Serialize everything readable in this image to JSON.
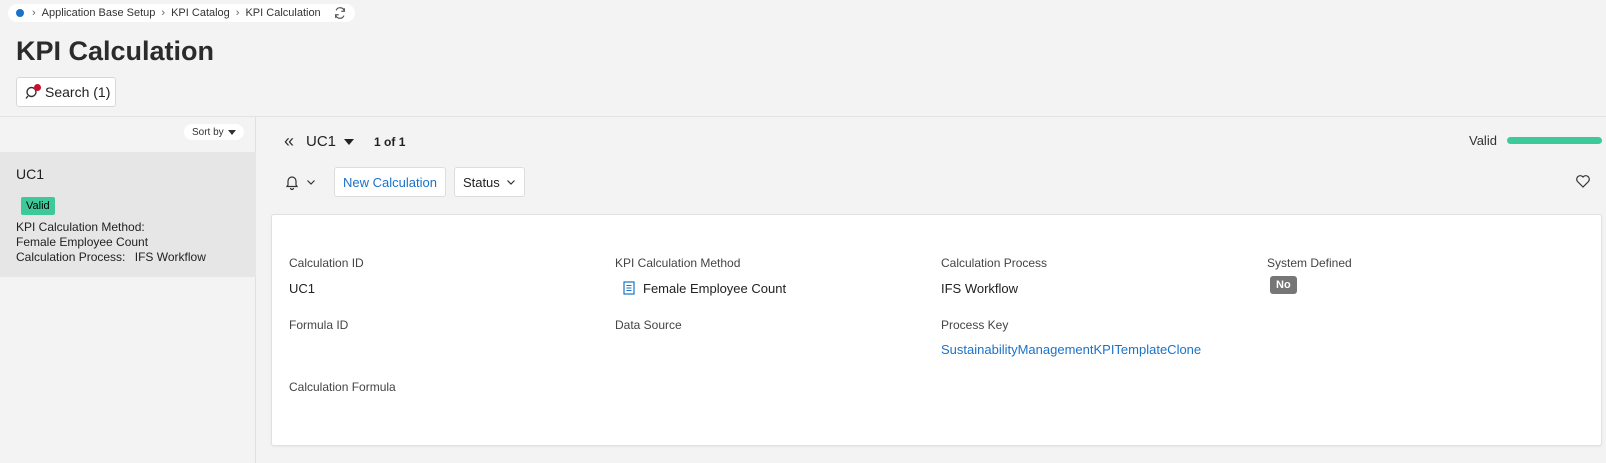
{
  "breadcrumb": {
    "items": [
      "Application Base Setup",
      "KPI Catalog",
      "KPI Calculation"
    ]
  },
  "page": {
    "title": "KPI Calculation"
  },
  "search": {
    "label": "Search (1)"
  },
  "list": {
    "sort_label": "Sort by",
    "items": [
      {
        "title": "UC1",
        "status": "Valid",
        "method_label": "KPI Calculation Method:",
        "method_value": "Female Employee Count",
        "process_label": "Calculation Process:",
        "process_value": "IFS Workflow"
      }
    ]
  },
  "record": {
    "name": "UC1",
    "count": "1 of 1",
    "status_text": "Valid",
    "status_progress": 1.0
  },
  "toolbar": {
    "new_calc": "New Calculation",
    "status": "Status"
  },
  "details": {
    "calc_id_label": "Calculation ID",
    "calc_id_value": "UC1",
    "method_label": "KPI Calculation Method",
    "method_value": "Female Employee Count",
    "process_label": "Calculation Process",
    "process_value": "IFS Workflow",
    "system_label": "System Defined",
    "system_value": "No",
    "formula_id_label": "Formula ID",
    "data_source_label": "Data Source",
    "process_key_label": "Process Key",
    "process_key_value": "SustainabilityManagementKPITemplateClone",
    "formula_label": "Calculation Formula"
  },
  "colors": {
    "accent": "#1a73c9",
    "valid": "#3ec99a",
    "badge_gray": "#767676"
  },
  "icons": [
    "home-icon",
    "refresh-icon",
    "search-icon",
    "double-chevron-left-icon",
    "bell-icon",
    "chevron-down-icon",
    "heart-icon",
    "document-icon"
  ]
}
